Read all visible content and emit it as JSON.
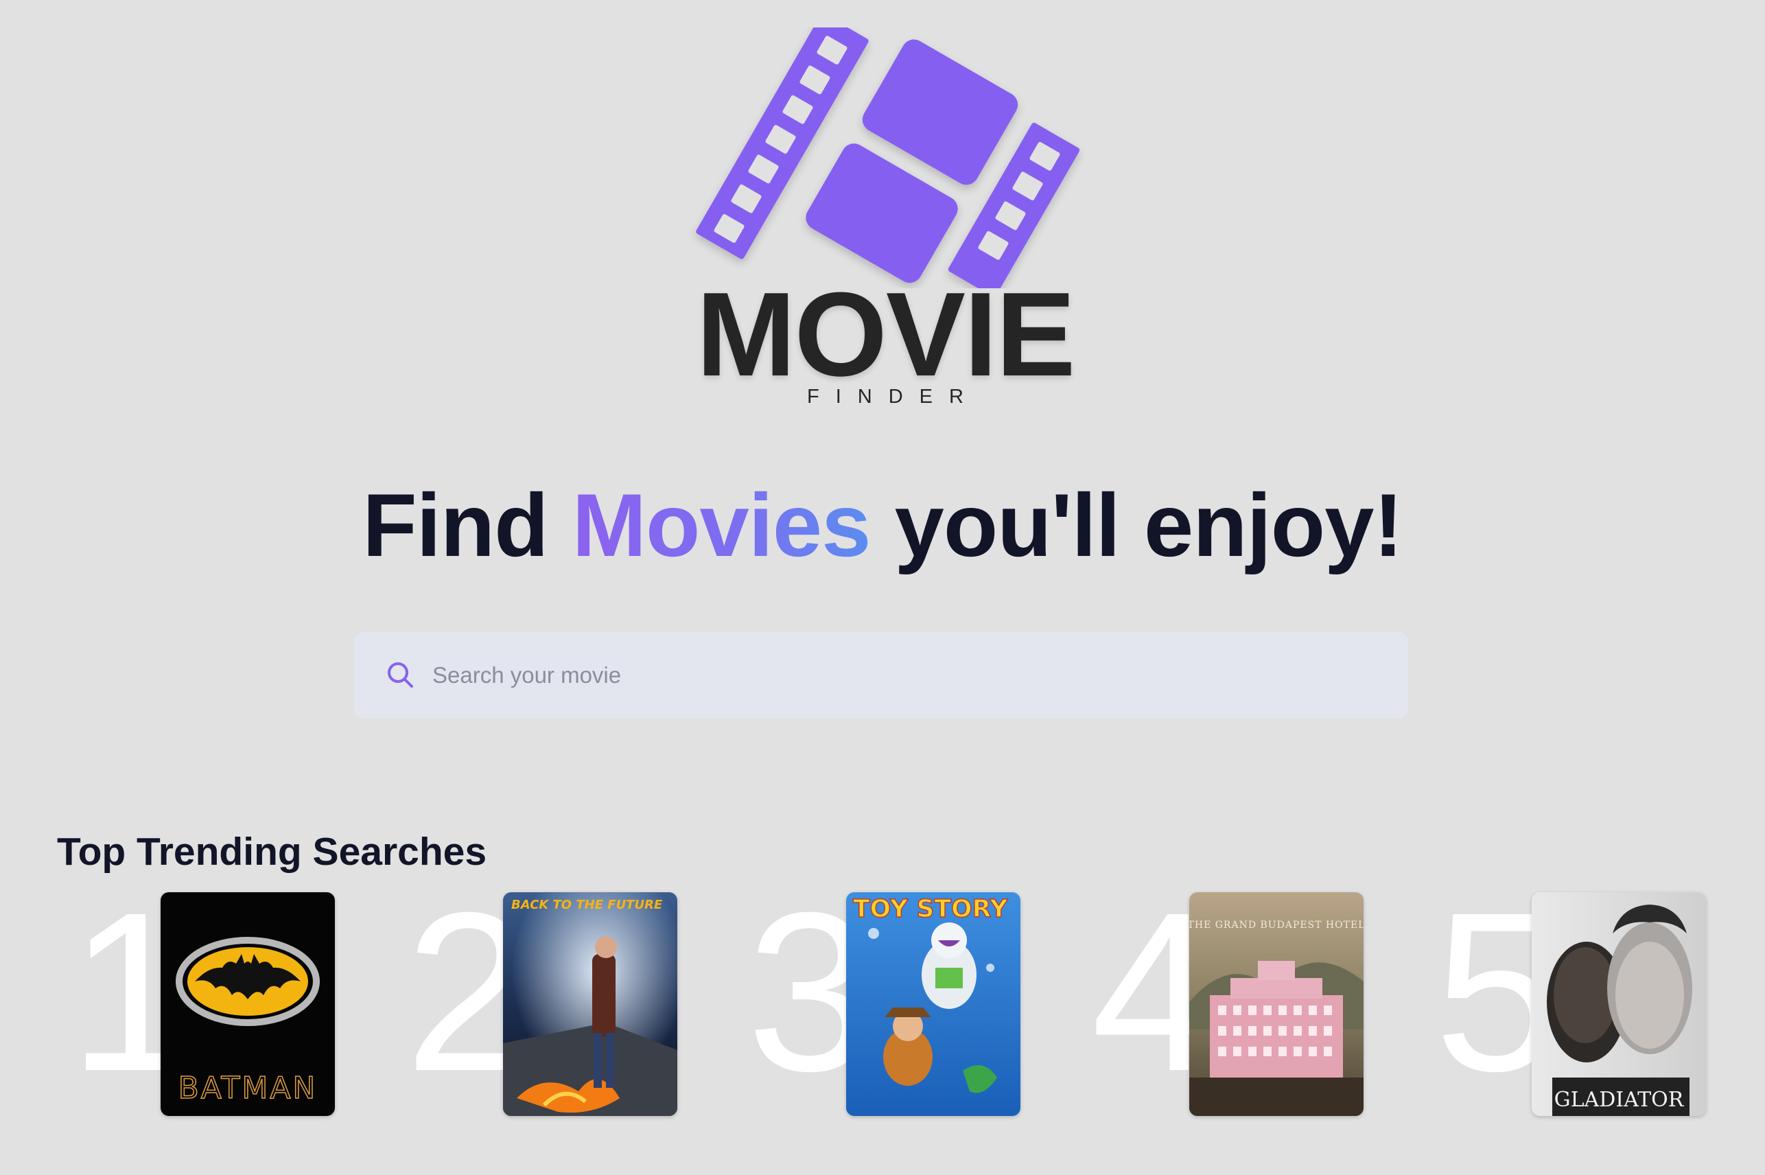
{
  "logo": {
    "word": "MOVIE",
    "sub": "FINDER"
  },
  "headline": {
    "before": "Find ",
    "accent": "Movies",
    "after": " you'll enjoy!"
  },
  "search": {
    "placeholder": "Search your movie",
    "value": ""
  },
  "trending": {
    "title": "Top Trending Searches",
    "items": [
      {
        "rank": "1",
        "poster_text": "BATMAN"
      },
      {
        "rank": "2",
        "poster_text": "BACK TO THE FUTURE"
      },
      {
        "rank": "3",
        "poster_text": "TOY STORY"
      },
      {
        "rank": "4",
        "poster_text": "THE GRAND BUDAPEST HOTEL"
      },
      {
        "rank": "5",
        "poster_text": "GLADIATOR"
      }
    ]
  },
  "colors": {
    "background": "#e1e1e1",
    "accent": "#8561f0",
    "text": "#121528",
    "search_bg": "#e3e6ee"
  }
}
